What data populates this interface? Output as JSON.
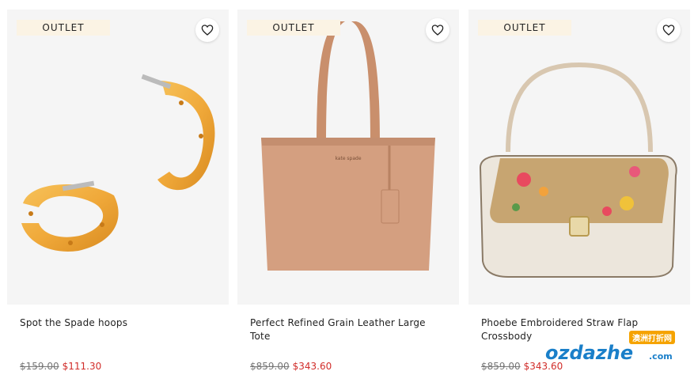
{
  "products": [
    {
      "badge": "OUTLET",
      "name": "Spot the Spade hoops",
      "old_price": "$159.00",
      "new_price": "$111.30"
    },
    {
      "badge": "OUTLET",
      "name": "Perfect Refined Grain Leather Large Tote",
      "old_price": "$859.00",
      "new_price": "$343.60"
    },
    {
      "badge": "OUTLET",
      "name": "Phoebe Embroidered Straw Flap Crossbody",
      "old_price": "$859.00",
      "new_price": "$343.60"
    }
  ],
  "watermark": {
    "tag": "澳洲打折网",
    "logo": "ozdazhe",
    "domain": ".com"
  },
  "colors": {
    "sale": "#d12d2a",
    "badge_bg": "#fbf3e4",
    "image_bg": "#f5f5f5"
  }
}
